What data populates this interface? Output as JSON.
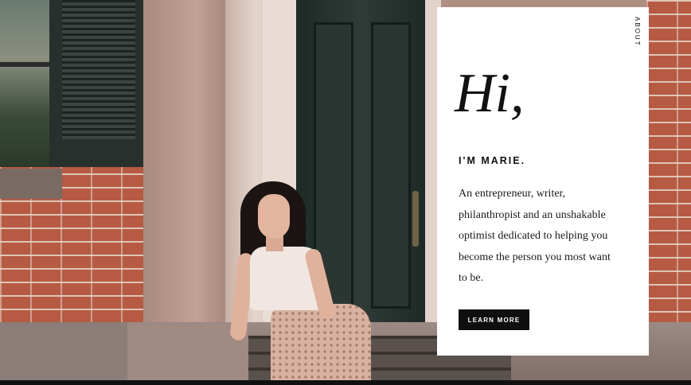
{
  "card": {
    "about_label": "ABOUT",
    "greeting": "Hi,",
    "name": "I'M MARIE.",
    "bio": "An entrepreneur, writer, philanthropist and an unshakable optimist dedicated to helping you become the person you most want to be.",
    "cta_label": "LEARN MORE"
  },
  "colors": {
    "card_background": "#ffffff",
    "text": "#111111",
    "button_background": "#0f0f0f",
    "button_text": "#ffffff"
  }
}
